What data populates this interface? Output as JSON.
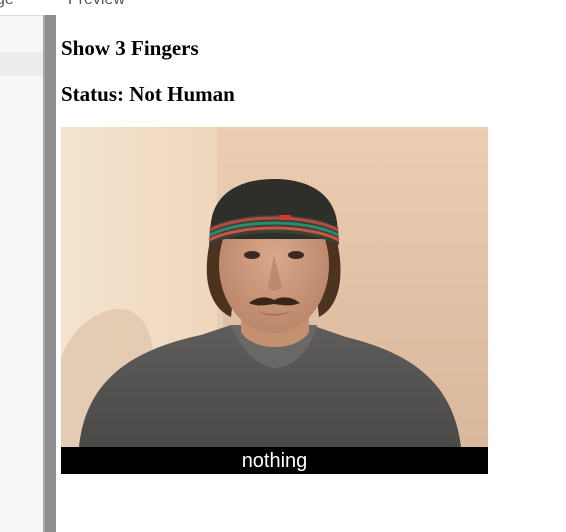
{
  "top_tabs": [
    "ge",
    "Preview"
  ],
  "preview": {
    "instruction": "Show 3 Fingers",
    "status": "Status: Not Human",
    "prediction_label": "nothing"
  },
  "colors": {
    "caption_bg": "#000000",
    "caption_text": "#ffffff",
    "divider": "#8f8f8f",
    "sidebar_bg": "#f7f7f7"
  }
}
